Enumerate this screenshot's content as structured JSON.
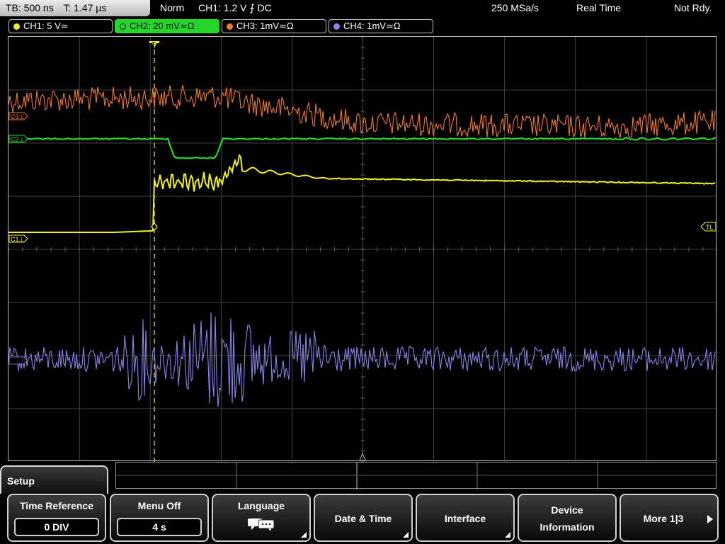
{
  "status": {
    "timebase": "TB: 500 ns",
    "time": "T: 1.47 µs",
    "mode": "Norm",
    "trigger": "CH1: 1.2 V ⨍ DC",
    "sample_rate": "250 MSa/s",
    "acq_mode": "Real Time",
    "state": "Not Rdy."
  },
  "channels": [
    {
      "label": "CH1: 5 V≃",
      "color": "#f2f21a",
      "active": false
    },
    {
      "label": "CH2: 20 mV≃Ω",
      "color": "#25d62a",
      "active": true
    },
    {
      "label": "CH3: 1mV≃Ω",
      "color": "#f07a2a",
      "active": false
    },
    {
      "label": "CH4: 1mV≃Ω",
      "color": "#8a86e8",
      "active": false
    }
  ],
  "markers": {
    "c3": "C3⊥",
    "c2": "C2⊥",
    "c1": "C1⊥",
    "trigger_level": "TL"
  },
  "menu": {
    "title": "Setup",
    "softkeys": [
      {
        "title": "Time Reference",
        "value": "0 DIV"
      },
      {
        "title": "Menu Off",
        "value": "4 s"
      },
      {
        "title": "Language",
        "icon": "speech-bubbles-icon"
      },
      {
        "title": "Date & Time"
      },
      {
        "title": "Interface"
      },
      {
        "title_line1": "Device",
        "title_line2": "Information"
      },
      {
        "title": "More 1|3",
        "icon": "arrow-right-icon"
      }
    ]
  },
  "colors": {
    "ch1": "#f2f21a",
    "ch2": "#25d62a",
    "ch3": "#f07a2a",
    "ch4": "#8a86e8",
    "grid": "#5a5a5a"
  }
}
